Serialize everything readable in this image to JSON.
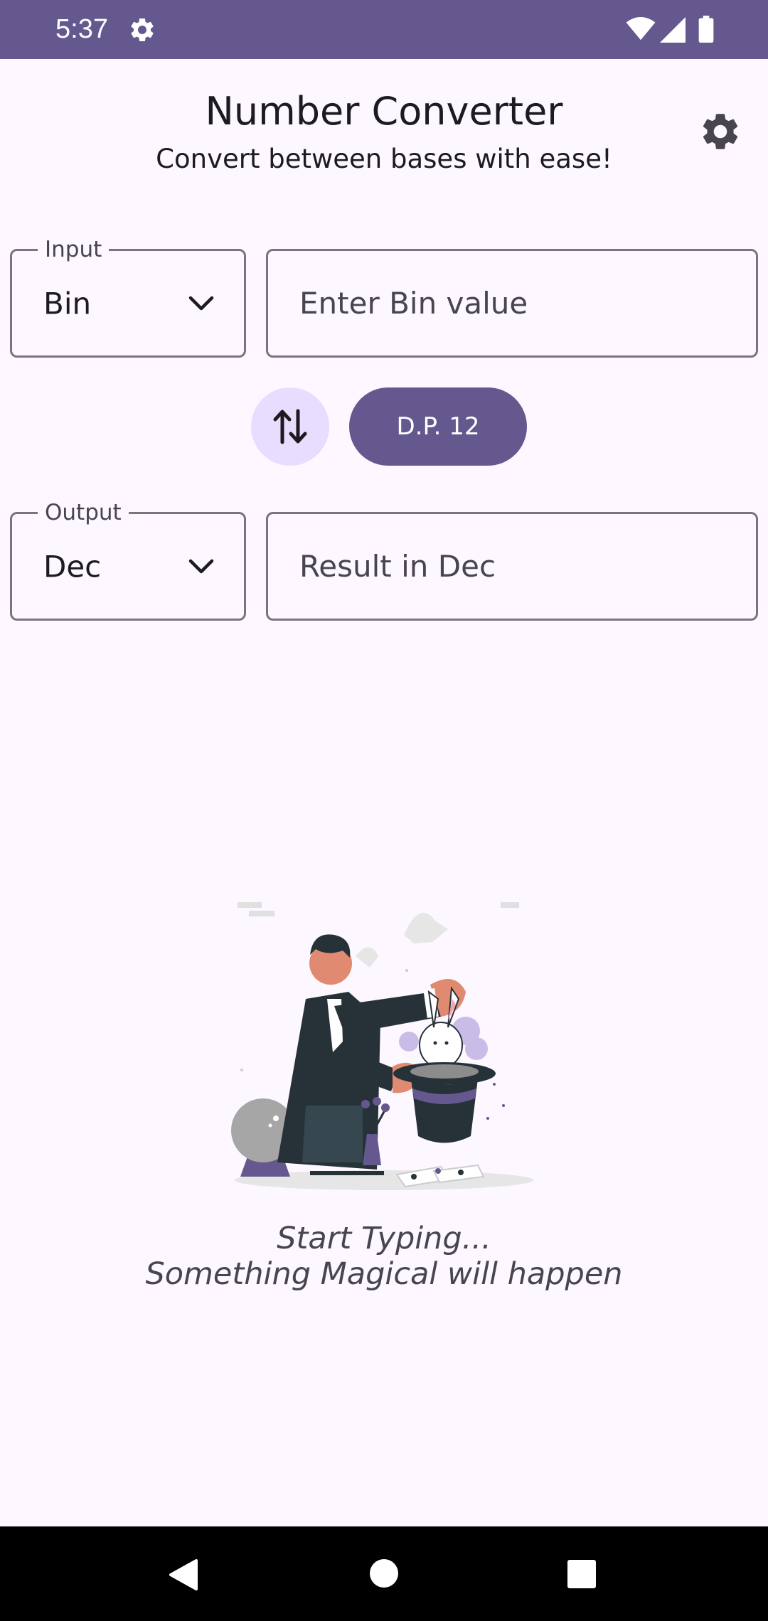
{
  "status_bar": {
    "time": "5:37",
    "icons": [
      "settings-icon",
      "wifi-icon",
      "signal-icon",
      "battery-icon"
    ],
    "background": "#65588f"
  },
  "header": {
    "title": "Number Converter",
    "subtitle": "Convert between bases with ease!",
    "settings_icon": "gear-icon"
  },
  "input": {
    "label": "Input",
    "base": "Bin",
    "placeholder": "Enter Bin value",
    "value": ""
  },
  "controls": {
    "swap_icon": "swap-vertical-icon",
    "dp_label": "D.P. 12"
  },
  "output": {
    "label": "Output",
    "base": "Dec",
    "placeholder": "Result in Dec",
    "value": ""
  },
  "empty_state": {
    "illustration": "magician-illustration",
    "line1": "Start Typing...",
    "line2": "Something Magical will happen"
  },
  "nav_bar": {
    "icons": [
      "back-icon",
      "home-icon",
      "recents-icon"
    ]
  },
  "colors": {
    "primary": "#65588f",
    "primary_container": "#e9ddff",
    "background": "#fdf7ff",
    "outline": "#79747e"
  }
}
